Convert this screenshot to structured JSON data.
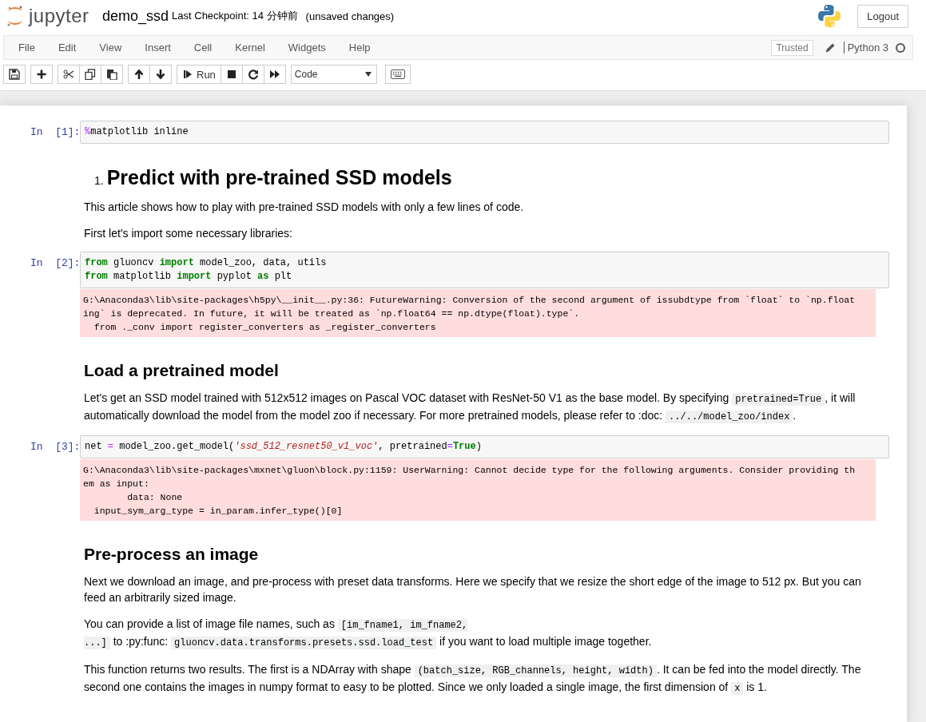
{
  "header": {
    "logo_text": "jupyter",
    "notebook_name": "demo_ssd",
    "checkpoint": "Last Checkpoint: 14 分钟前",
    "autosave_status": "(unsaved changes)",
    "logout": "Logout"
  },
  "menubar": {
    "items": [
      "File",
      "Edit",
      "View",
      "Insert",
      "Cell",
      "Kernel",
      "Widgets",
      "Help"
    ],
    "trusted": "Trusted",
    "kernel_name": "Python 3",
    "kernel_busy": false
  },
  "toolbar": {
    "run_label": "Run",
    "cell_type": "Code"
  },
  "cells": [
    {
      "kind": "code",
      "prompt": "In  [1]:",
      "lines": [
        [
          {
            "kind": "magic",
            "text": "%"
          },
          {
            "kind": "plain",
            "text": "matplotlib inline"
          }
        ]
      ]
    },
    {
      "kind": "h1",
      "number": "1.",
      "text": "Predict with pre-trained SSD models"
    },
    {
      "kind": "p",
      "segments": [
        {
          "kind": "text",
          "text": "This article shows how to play with pre-trained SSD models with only a few lines of code."
        }
      ]
    },
    {
      "kind": "p",
      "segments": [
        {
          "kind": "text",
          "text": "First let's import some necessary libraries:"
        }
      ]
    },
    {
      "kind": "code",
      "prompt": "In  [2]:",
      "lines": [
        [
          {
            "kind": "kw",
            "text": "from"
          },
          {
            "kind": "plain",
            "text": " gluoncv "
          },
          {
            "kind": "kw",
            "text": "import"
          },
          {
            "kind": "plain",
            "text": " model_zoo, data, utils"
          }
        ],
        [
          {
            "kind": "kw",
            "text": "from"
          },
          {
            "kind": "plain",
            "text": " matplotlib "
          },
          {
            "kind": "kw",
            "text": "import"
          },
          {
            "kind": "plain",
            "text": " pyplot "
          },
          {
            "kind": "kw",
            "text": "as"
          },
          {
            "kind": "plain",
            "text": " plt"
          }
        ]
      ],
      "stderr": [
        "G:\\Anaconda3\\lib\\site-packages\\h5py\\__init__.py:36: FutureWarning: Conversion of the second argument of issubdtype from `float` to `np.float",
        "ing` is deprecated. In future, it will be treated as `np.float64 == np.dtype(float).type`.",
        "  from ._conv import register_converters as _register_converters"
      ]
    },
    {
      "kind": "h2",
      "text": "Load a pretrained model"
    },
    {
      "kind": "p",
      "segments": [
        {
          "kind": "text",
          "text": "Let's get an SSD model trained with 512x512 images on Pascal VOC dataset with ResNet-50 V1 as the base model. By specifying "
        },
        {
          "kind": "code",
          "text": "pretrained=True"
        },
        {
          "kind": "text",
          "text": ", it will automatically download the model from the model zoo if necessary. For more pretrained models, please refer to :doc: "
        },
        {
          "kind": "code",
          "text": "../../model_zoo/index"
        },
        {
          "kind": "text",
          "text": "."
        }
      ]
    },
    {
      "kind": "code",
      "prompt": "In  [3]:",
      "lines": [
        [
          {
            "kind": "plain",
            "text": "net "
          },
          {
            "kind": "op",
            "text": "="
          },
          {
            "kind": "plain",
            "text": " model_zoo.get_model("
          },
          {
            "kind": "str",
            "text": "'ssd_512_resnet50_v1_voc'"
          },
          {
            "kind": "plain",
            "text": ", pretrained"
          },
          {
            "kind": "op",
            "text": "="
          },
          {
            "kind": "kw",
            "text": "True"
          },
          {
            "kind": "plain",
            "text": ")"
          }
        ]
      ],
      "stderr": [
        "G:\\Anaconda3\\lib\\site-packages\\mxnet\\gluon\\block.py:1159: UserWarning: Cannot decide type for the following arguments. Consider providing th",
        "em as input:",
        "        data: None",
        "  input_sym_arg_type = in_param.infer_type()[0]"
      ]
    },
    {
      "kind": "h2",
      "text": "Pre-process an image"
    },
    {
      "kind": "p",
      "segments": [
        {
          "kind": "text",
          "text": "Next we download an image, and pre-process with preset data transforms. Here we specify that we resize the short edge of the image to 512 px. But you can feed an arbitrarily sized image."
        }
      ]
    },
    {
      "kind": "p",
      "segments": [
        {
          "kind": "text",
          "text": "You can provide a list of image file names, such as "
        },
        {
          "kind": "code",
          "text": "[im_fname1, im_fname2,\n...]"
        },
        {
          "kind": "text",
          "text": " to :py:func: "
        },
        {
          "kind": "code",
          "text": "gluoncv.data.transforms.presets.ssd.load_test"
        },
        {
          "kind": "text",
          "text": " if you want to load multiple image together."
        }
      ]
    },
    {
      "kind": "p",
      "segments": [
        {
          "kind": "text",
          "text": "This function returns two results. The first is a NDArray with shape "
        },
        {
          "kind": "code",
          "text": "(batch_size, RGB_channels, height, width)"
        },
        {
          "kind": "text",
          "text": ". It can be fed into the model directly. The second one contains the images in numpy format to easy to be plotted. Since we only loaded a single image, the first dimension of "
        },
        {
          "kind": "code",
          "text": "x"
        },
        {
          "kind": "text",
          "text": " is 1."
        }
      ]
    }
  ]
}
